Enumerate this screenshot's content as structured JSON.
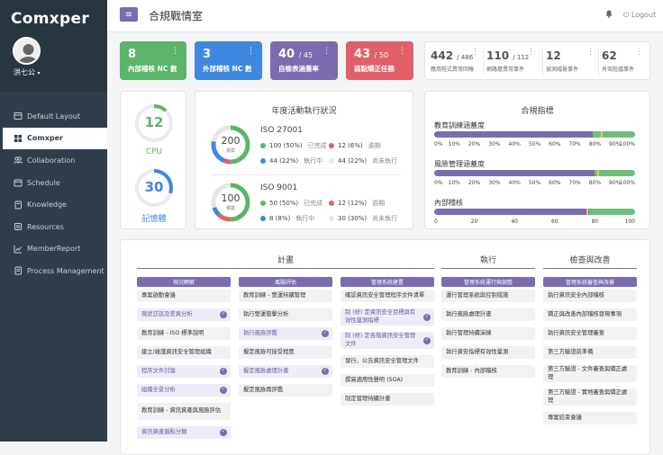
{
  "app": {
    "logo": "Comxper",
    "user": "洪七公",
    "user_caret": "▾"
  },
  "header": {
    "title": "合規戰情室",
    "logout": "Logout",
    "menu_icon": "≡"
  },
  "nav": [
    {
      "label": "Default Layout",
      "icon": "layout-icon",
      "active": false
    },
    {
      "label": "Comxper",
      "icon": "dashboard-icon",
      "active": true
    },
    {
      "label": "Collaboration",
      "icon": "people-icon",
      "active": false
    },
    {
      "label": "Schedule",
      "icon": "calendar-icon",
      "active": false
    },
    {
      "label": "Knowledge",
      "icon": "book-icon",
      "active": false
    },
    {
      "label": "Resources",
      "icon": "folder-icon",
      "active": false
    },
    {
      "label": "MemberReport",
      "icon": "report-icon",
      "active": false
    },
    {
      "label": "Process Management",
      "icon": "process-icon",
      "active": false
    }
  ],
  "stats": [
    {
      "value": "8",
      "total": "",
      "label": "內部稽核 NC 數",
      "color": "#5cb46a"
    },
    {
      "value": "3",
      "total": "",
      "label": "外部稽核 NC 數",
      "color": "#3f88e0"
    },
    {
      "value": "40",
      "total": "/ 45",
      "label": "自檢表涵蓋率",
      "color": "#7b6bb0"
    },
    {
      "value": "43",
      "total": "/ 50",
      "label": "弱點矯正任務",
      "color": "#e35f67"
    }
  ],
  "mini_stats": [
    {
      "value": "442",
      "total": "/ 486",
      "label": "應用程式異常回報"
    },
    {
      "value": "110",
      "total": "/ 112",
      "label": "網路層異常事件"
    },
    {
      "value": "12",
      "total": "",
      "label": "偵測威脅事件"
    },
    {
      "value": "62",
      "total": "",
      "label": "有效阻擋事件"
    }
  ],
  "gauges": [
    {
      "value": "12",
      "label": "CPU",
      "color": "#5cb46a",
      "percent": 12
    },
    {
      "value": "30",
      "label": "記憶體",
      "color": "#3f88e0",
      "percent": 30
    }
  ],
  "annual": {
    "title": "年度活動執行狀況",
    "unit": "積案",
    "items": [
      {
        "name": "ISO 27001",
        "total": "200",
        "legend": [
          {
            "text": "100 (50%)",
            "label": "已完成",
            "color": "#5cb46a"
          },
          {
            "text": "12 (6%)",
            "label": "逾期",
            "color": "#e35f67"
          },
          {
            "text": "44 (22%)",
            "label": "執行中",
            "color": "#3f88e0"
          },
          {
            "text": "44 (22%)",
            "label": "尚未執行",
            "color": "#e6e6e6"
          }
        ],
        "parts": [
          50,
          6,
          22,
          22
        ]
      },
      {
        "name": "ISO 9001",
        "total": "100",
        "legend": [
          {
            "text": "50 (50%)",
            "label": "已完成",
            "color": "#5cb46a"
          },
          {
            "text": "12 (12%)",
            "label": "逾期",
            "color": "#e35f67"
          },
          {
            "text": "8 (8%)",
            "label": "執行中",
            "color": "#3f88e0"
          },
          {
            "text": "30 (30%)",
            "label": "尚未執行",
            "color": "#e6e6e6"
          }
        ],
        "parts": [
          50,
          12,
          8,
          30
        ]
      }
    ]
  },
  "compliance": {
    "title": "合規指標",
    "bars": [
      {
        "name": "教育訓練涵蓋度",
        "purple": 79,
        "green": 21,
        "marker": 83,
        "ticks": [
          "0%",
          "10%",
          "20%",
          "30%",
          "40%",
          "50%",
          "60%",
          "70%",
          "80%",
          "90%",
          "100%"
        ]
      },
      {
        "name": "風險管理涵蓋度",
        "purple": 80,
        "green": 20,
        "marker": 81,
        "ticks": [
          "0%",
          "10%",
          "20%",
          "30%",
          "40%",
          "50%",
          "60%",
          "70%",
          "80%",
          "90%",
          "100%"
        ]
      },
      {
        "name": "內部稽核",
        "purple": 77,
        "green": 23,
        "marker": 76,
        "ticks": [
          "0",
          "20",
          "40",
          "60",
          "80",
          "100"
        ]
      }
    ]
  },
  "plan": {
    "groups": [
      {
        "title": "計畫",
        "columns": [
          "現況瞭解",
          "風險評估",
          "管理系統建置"
        ]
      },
      {
        "title": "執行",
        "columns": [
          "管理系統運行與調整"
        ]
      },
      {
        "title": "檢查與改善",
        "columns": [
          "管理系統審查與改善"
        ]
      }
    ],
    "tasks": [
      [
        {
          "text": "專案啟動會議",
          "done": false
        },
        {
          "text": "現狀訪談及差異分析",
          "done": true
        },
        {
          "text": "教育訓練 - ISO 標準說明",
          "done": false
        },
        {
          "text": "建立/維護資訊安全管理組織",
          "done": false
        },
        {
          "text": "程序文件討論",
          "done": true
        },
        {
          "text": "組織全景分析",
          "done": true
        },
        {
          "text": "教育訓練 - 資訊資產與風險評估",
          "done": false
        },
        {
          "text": "資訊資產盤點分類",
          "done": true
        }
      ],
      [
        {
          "text": "教育訓練 - 營運持續管理",
          "done": false
        },
        {
          "text": "執行營運衝擊分析",
          "done": false
        },
        {
          "text": "執行風險評鑑",
          "done": true
        },
        {
          "text": "擬定風險可接受程度",
          "done": false
        },
        {
          "text": "擬定風險處理計畫",
          "done": true
        },
        {
          "text": "擬定風險再評鑑",
          "done": false
        }
      ],
      [
        {
          "text": "確認資訊安全管理程序文件清單",
          "done": false
        },
        {
          "text": "制 (修) 定資訊安全目標與有效性量測指標",
          "done": true
        },
        {
          "text": "制 (修) 定各階資訊安全管理文件",
          "done": true
        },
        {
          "text": "發行、公告資訊安全管理文件",
          "done": false
        },
        {
          "text": "撰寫適用性聲明 (SOA)",
          "done": false
        },
        {
          "text": "制定管理持續計畫",
          "done": false
        }
      ],
      [
        {
          "text": "運行管理系統與控制措施",
          "done": false
        },
        {
          "text": "執行風險處理計畫",
          "done": false
        },
        {
          "text": "執行管理持續演練",
          "done": false
        },
        {
          "text": "執行資安指標有效性量測",
          "done": false
        },
        {
          "text": "教育訓練 - 內部稽核",
          "done": false
        }
      ],
      [
        {
          "text": "執行資訊安全內部稽核",
          "done": false
        },
        {
          "text": "矯正與改善內部稽核發現事項",
          "done": false
        },
        {
          "text": "執行資訊安全管理審查",
          "done": false
        },
        {
          "text": "第三方驗證前準備",
          "done": false
        },
        {
          "text": "第三方驗證 - 文件審查與矯正處理",
          "done": false
        },
        {
          "text": "第三方驗證 - 實地審查與矯正處理",
          "done": false
        },
        {
          "text": "專案結束會議",
          "done": false
        }
      ]
    ]
  }
}
